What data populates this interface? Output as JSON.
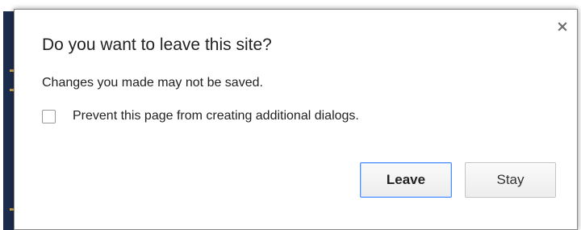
{
  "dialog": {
    "title": "Do you want to leave this site?",
    "message": "Changes you made may not be saved.",
    "prevent_checkbox_label": "Prevent this page from creating additional dialogs.",
    "prevent_checkbox_checked": false,
    "close_icon": "close-icon",
    "leave_label": "Leave",
    "stay_label": "Stay"
  },
  "colors": {
    "focus_border": "#4d90fe",
    "text": "#222222"
  }
}
